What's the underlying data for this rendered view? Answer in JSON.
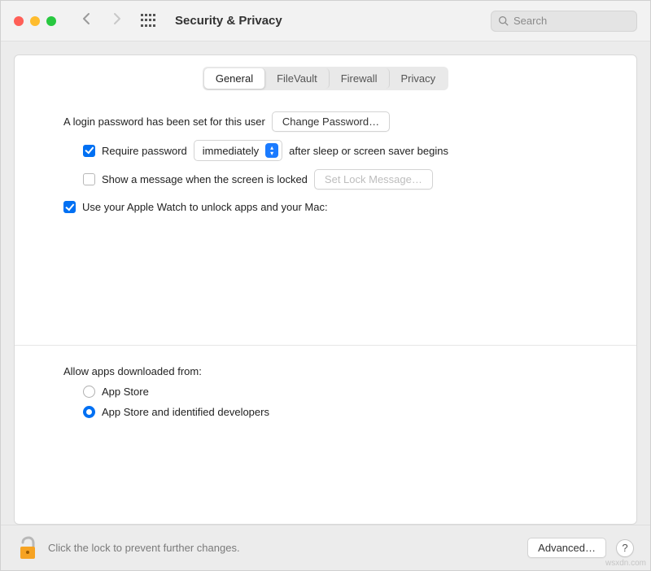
{
  "window": {
    "title": "Security & Privacy"
  },
  "search": {
    "placeholder": "Search"
  },
  "tabs": {
    "items": [
      {
        "label": "General",
        "active": true
      },
      {
        "label": "FileVault",
        "active": false
      },
      {
        "label": "Firewall",
        "active": false
      },
      {
        "label": "Privacy",
        "active": false
      }
    ]
  },
  "general": {
    "login_password_set": "A login password has been set for this user",
    "change_password": "Change Password…",
    "require_password_label": "Require password",
    "require_password_value": "immediately",
    "require_password_suffix": "after sleep or screen saver begins",
    "show_message_label": "Show a message when the screen is locked",
    "set_lock_message": "Set Lock Message…",
    "apple_watch_label": "Use your Apple Watch to unlock apps and your Mac:"
  },
  "downloads": {
    "heading": "Allow apps downloaded from:",
    "options": [
      {
        "label": "App Store",
        "selected": false
      },
      {
        "label": "App Store and identified developers",
        "selected": true
      }
    ]
  },
  "footer": {
    "lock_text": "Click the lock to prevent further changes.",
    "advanced": "Advanced…",
    "help": "?"
  },
  "watermark": "wsxdn.com"
}
